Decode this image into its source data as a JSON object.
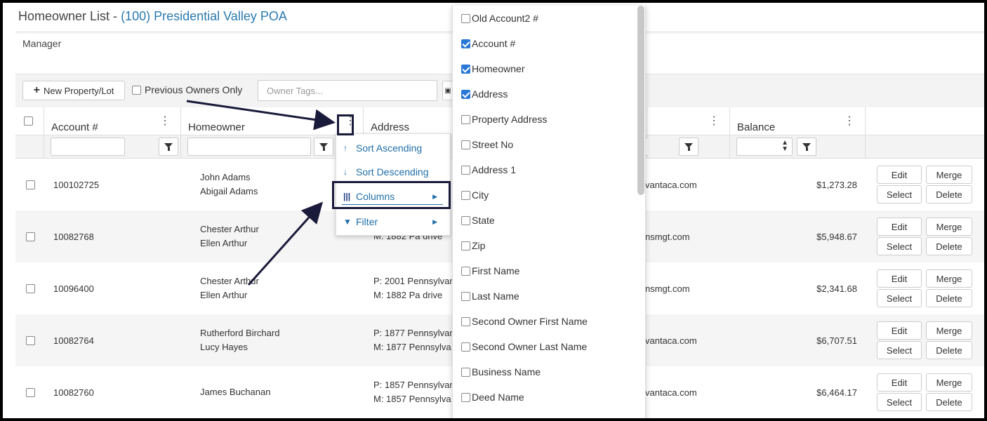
{
  "page": {
    "title_prefix": "Homeowner List - ",
    "association": "(100) Presidential Valley POA",
    "manager": "Manager"
  },
  "toolbar": {
    "new_button": "New Property/Lot",
    "previous_owners": "Previous Owners Only",
    "tags_placeholder": "Owner Tags..."
  },
  "columns": {
    "account": "Account #",
    "homeowner": "Homeowner",
    "address": "Address",
    "balance": "Balance"
  },
  "rows": [
    {
      "account": "100102725",
      "owner1": "John Adams",
      "owner2": "Abigail Adams",
      "addr1": "",
      "addr2": "",
      "email": "vantaca.com",
      "balance": "$1,273.28"
    },
    {
      "account": "10082768",
      "owner1": "Chester Arthur",
      "owner2": "Ellen Arthur",
      "addr1": "",
      "addr2": "M: 1882 Pa drive",
      "email": "nsmgt.com",
      "balance": "$5,948.67"
    },
    {
      "account": "10096400",
      "owner1": "Chester Arthur",
      "owner2": "Ellen Arthur",
      "addr1": "P: 2001 Pennsylvan",
      "addr2": "M: 1882 Pa drive",
      "email": "nsmgt.com",
      "balance": "$2,341.68"
    },
    {
      "account": "10082764",
      "owner1": "Rutherford Birchard",
      "owner2": "Lucy Hayes",
      "addr1": "P: 1877 Pennsylvan",
      "addr2": "M: 1877 Pennsylva",
      "email": "vantaca.com",
      "balance": "$6,707.51"
    },
    {
      "account": "10082760",
      "owner1": "James Buchanan",
      "owner2": "",
      "addr1": "P: 1857 Pennsylvan",
      "addr2": "M: 1857 Pennsylva",
      "email": "vantaca.com",
      "balance": "$6,464.17"
    }
  ],
  "row_actions": {
    "edit": "Edit",
    "merge": "Merge",
    "select": "Select",
    "delete": "Delete"
  },
  "context_menu": {
    "sort_asc": "Sort Ascending",
    "sort_desc": "Sort Descending",
    "columns": "Columns",
    "filter": "Filter"
  },
  "column_options": [
    {
      "label": "Old Account2 #",
      "checked": false
    },
    {
      "label": "Account #",
      "checked": true
    },
    {
      "label": "Homeowner",
      "checked": true
    },
    {
      "label": "Address",
      "checked": true
    },
    {
      "label": "Property Address",
      "checked": false
    },
    {
      "label": "Street No",
      "checked": false
    },
    {
      "label": "Address 1",
      "checked": false
    },
    {
      "label": "City",
      "checked": false
    },
    {
      "label": "State",
      "checked": false
    },
    {
      "label": "Zip",
      "checked": false
    },
    {
      "label": "First Name",
      "checked": false
    },
    {
      "label": "Last Name",
      "checked": false
    },
    {
      "label": "Second Owner First Name",
      "checked": false
    },
    {
      "label": "Second Owner Last Name",
      "checked": false
    },
    {
      "label": "Business Name",
      "checked": false
    },
    {
      "label": "Deed Name",
      "checked": false
    }
  ],
  "colors": {
    "accent": "#2a7ab0",
    "checkbox": "#2a78d6",
    "highlight": "#1a1a3a"
  }
}
